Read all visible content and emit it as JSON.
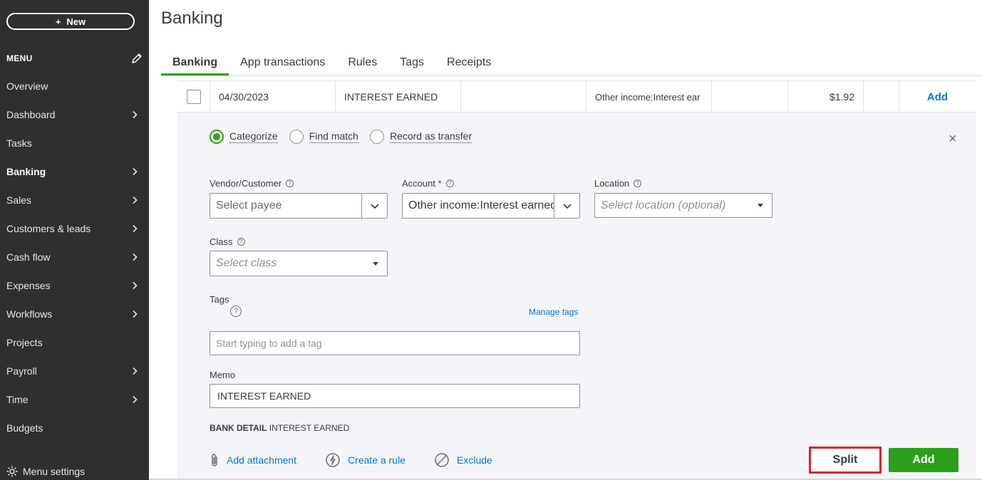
{
  "sidebar": {
    "new_label": "New",
    "new_icon": "+",
    "menu_label": "MENU",
    "items": [
      {
        "label": "Overview",
        "chevron": false
      },
      {
        "label": "Dashboard",
        "chevron": true
      },
      {
        "label": "Tasks",
        "chevron": false
      },
      {
        "label": "Banking",
        "chevron": true,
        "active": true
      },
      {
        "label": "Sales",
        "chevron": true
      },
      {
        "label": "Customers & leads",
        "chevron": true
      },
      {
        "label": "Cash flow",
        "chevron": true
      },
      {
        "label": "Expenses",
        "chevron": true
      },
      {
        "label": "Workflows",
        "chevron": true
      },
      {
        "label": "Projects",
        "chevron": false
      },
      {
        "label": "Payroll",
        "chevron": true
      },
      {
        "label": "Time",
        "chevron": true
      },
      {
        "label": "Budgets",
        "chevron": false
      }
    ],
    "menu_settings_label": "Menu settings"
  },
  "header": {
    "title": "Banking",
    "tabs": [
      "Banking",
      "App transactions",
      "Rules",
      "Tags",
      "Receipts"
    ],
    "active_tab": "Banking"
  },
  "transaction": {
    "date": "04/30/2023",
    "description": "INTEREST EARNED",
    "payee": "",
    "category": "Other income:Interest ear",
    "spent": "",
    "received": "$1.92",
    "action_label": "Add"
  },
  "panel": {
    "radio_options": [
      {
        "label": "Categorize",
        "selected": true
      },
      {
        "label": "Find match",
        "selected": false
      },
      {
        "label": "Record as transfer",
        "selected": false
      }
    ],
    "close_icon": "×",
    "vendor_label": "Vendor/Customer",
    "vendor_placeholder": "Select payee",
    "account_label": "Account *",
    "account_value": "Other income:Interest earned",
    "location_label": "Location",
    "location_placeholder": "Select location (optional)",
    "class_label": "Class",
    "class_placeholder": "Select class",
    "tags_label": "Tags",
    "manage_tags_label": "Manage tags",
    "tags_placeholder": "Start typing to add a tag",
    "memo_label": "Memo",
    "memo_value": "INTEREST EARNED",
    "bank_detail_label": "BANK DETAIL",
    "bank_detail_value": "INTEREST EARNED",
    "help_icon": "?",
    "actions": {
      "attachment": "Add attachment",
      "rule": "Create a rule",
      "exclude": "Exclude"
    },
    "split_label": "Split",
    "add_label": "Add"
  },
  "colors": {
    "sidebar_bg": "#2d2f31",
    "accent_green": "#2ca01c",
    "link_blue": "#0077c5",
    "highlight_red": "#e0202a",
    "panel_bg": "#f4f5f8"
  }
}
